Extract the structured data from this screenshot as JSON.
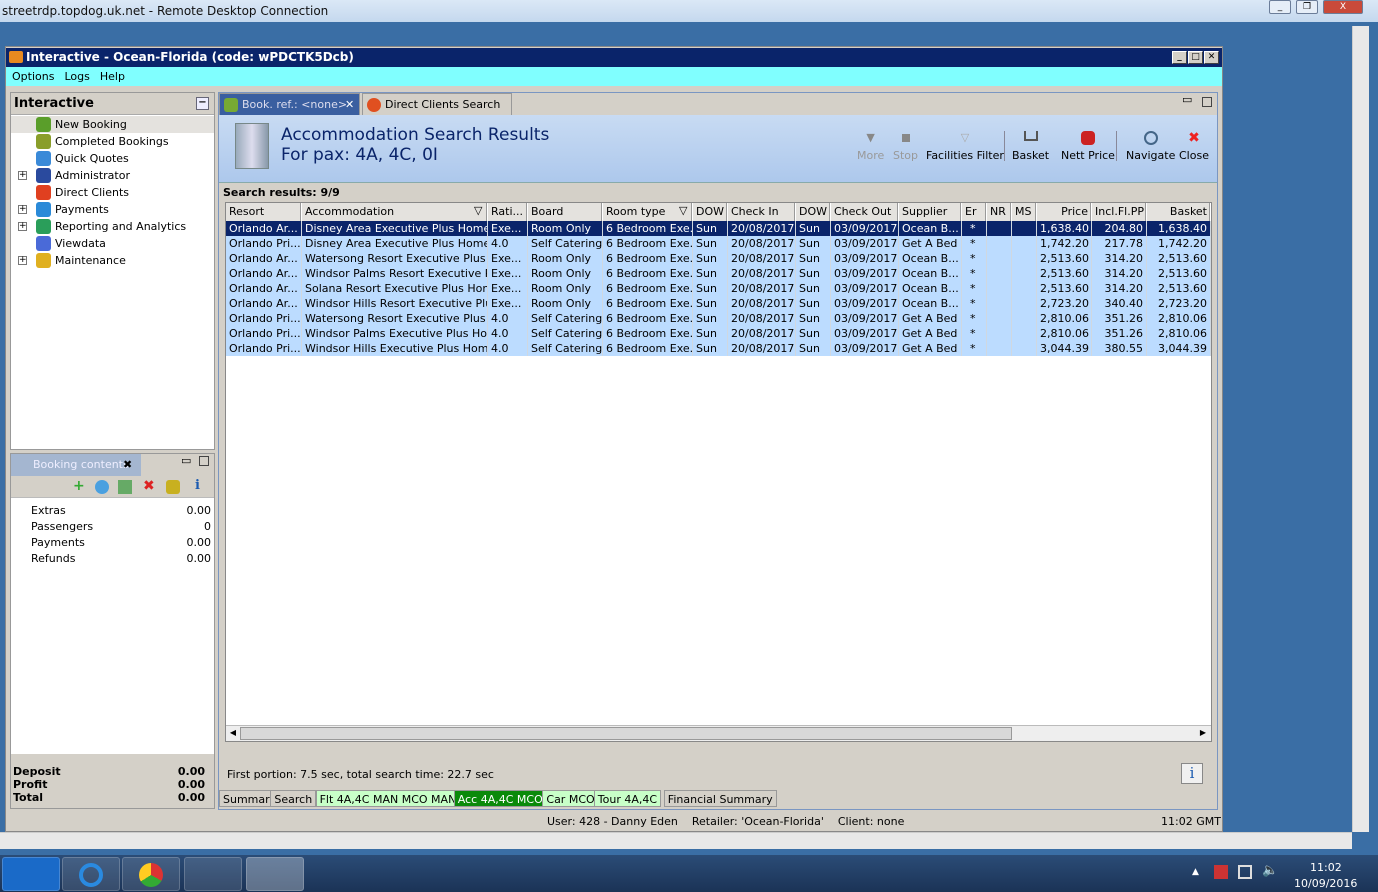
{
  "rdp": {
    "title": "streetrdp.topdog.uk.net - Remote Desktop Connection",
    "minimize": "_",
    "restore": "❐",
    "close": "X"
  },
  "app": {
    "title": "Interactive - Ocean-Florida (code: wPDCTK5Dcb)",
    "menu": [
      "Options",
      "Logs",
      "Help"
    ]
  },
  "left": {
    "title": "Interactive",
    "items": [
      {
        "label": "New Booking",
        "expand": false,
        "color": "#5a9e2a"
      },
      {
        "label": "Completed Bookings",
        "expand": false,
        "color": "#8a9e2a"
      },
      {
        "label": "Quick Quotes",
        "expand": false,
        "color": "#3a8ad8"
      },
      {
        "label": "Administrator",
        "expand": true,
        "color": "#2a4a9e"
      },
      {
        "label": "Direct Clients",
        "expand": false,
        "color": "#e04020"
      },
      {
        "label": "Payments",
        "expand": true,
        "color": "#2a8ad8"
      },
      {
        "label": "Reporting and Analytics",
        "expand": true,
        "color": "#2a9e5a"
      },
      {
        "label": "Viewdata",
        "expand": false,
        "color": "#4a6ad8"
      },
      {
        "label": "Maintenance",
        "expand": true,
        "color": "#e0b020"
      }
    ]
  },
  "booking_contents": {
    "tab": "Booking contents",
    "rows": [
      {
        "label": "Extras",
        "value": "0.00"
      },
      {
        "label": "Passengers",
        "value": "0"
      },
      {
        "label": "Payments",
        "value": "0.00"
      },
      {
        "label": "Refunds",
        "value": "0.00"
      }
    ],
    "summary": [
      {
        "label": "Deposit",
        "value": "0.00"
      },
      {
        "label": "Profit",
        "value": "0.00"
      },
      {
        "label": "Total",
        "value": "0.00"
      }
    ]
  },
  "tabs": [
    {
      "label": "Book. ref.: <none>"
    },
    {
      "label": "Direct Clients Search"
    }
  ],
  "header": {
    "title": "Accommodation Search Results",
    "subtitle": "For pax: 4A, 4C, 0I"
  },
  "toolbar": [
    "More",
    "Stop",
    "Facilities Filter",
    "Basket",
    "Nett Price",
    "Navigate",
    "Close"
  ],
  "results_label": "Search results: 9/9",
  "table": {
    "columns": [
      "Resort",
      "Accommodation",
      "Rati...",
      "Board",
      "Room type",
      "DOW",
      "Check In",
      "DOW",
      "Check Out",
      "Supplier",
      "Er",
      "NR",
      "MS",
      "Price",
      "Incl.Fl.PP",
      "Basket"
    ],
    "rows": [
      [
        "Orlando Ar...",
        "Disney Area Executive Plus Homes",
        "Exe...",
        "Room Only",
        "6 Bedroom Exe...",
        "Sun",
        "20/08/2017",
        "Sun",
        "03/09/2017",
        "Ocean B...",
        "*",
        "",
        "",
        "1,638.40",
        "204.80",
        "1,638.40"
      ],
      [
        "Orlando Pri...",
        "Disney Area Executive Plus Homes",
        "4.0",
        "Self Catering",
        "6 Bedroom Exe...",
        "Sun",
        "20/08/2017",
        "Sun",
        "03/09/2017",
        "Get A Bed",
        "*",
        "",
        "",
        "1,742.20",
        "217.78",
        "1,742.20"
      ],
      [
        "Orlando Ar...",
        "Watersong Resort Executive Plus ...",
        "Exe...",
        "Room Only",
        "6 Bedroom Exe...",
        "Sun",
        "20/08/2017",
        "Sun",
        "03/09/2017",
        "Ocean B...",
        "*",
        "",
        "",
        "2,513.60",
        "314.20",
        "2,513.60"
      ],
      [
        "Orlando Ar...",
        "Windsor Palms Resort Executive Pl...",
        "Exe...",
        "Room Only",
        "6 Bedroom Exe...",
        "Sun",
        "20/08/2017",
        "Sun",
        "03/09/2017",
        "Ocean B...",
        "*",
        "",
        "",
        "2,513.60",
        "314.20",
        "2,513.60"
      ],
      [
        "Orlando Ar...",
        "Solana Resort Executive Plus Homes",
        "Exe...",
        "Room Only",
        "6 Bedroom Exe...",
        "Sun",
        "20/08/2017",
        "Sun",
        "03/09/2017",
        "Ocean B...",
        "*",
        "",
        "",
        "2,513.60",
        "314.20",
        "2,513.60"
      ],
      [
        "Orlando Ar...",
        "Windsor Hills Resort Executive Plus...",
        "Exe...",
        "Room Only",
        "6 Bedroom Exe...",
        "Sun",
        "20/08/2017",
        "Sun",
        "03/09/2017",
        "Ocean B...",
        "*",
        "",
        "",
        "2,723.20",
        "340.40",
        "2,723.20"
      ],
      [
        "Orlando Pri...",
        "Watersong Resort Executive Plus ...",
        "4.0",
        "Self Catering",
        "6 Bedroom Exe...",
        "Sun",
        "20/08/2017",
        "Sun",
        "03/09/2017",
        "Get A Bed",
        "*",
        "",
        "",
        "2,810.06",
        "351.26",
        "2,810.06"
      ],
      [
        "Orlando Pri...",
        "Windsor Palms Executive Plus Homes",
        "4.0",
        "Self Catering",
        "6 Bedroom Exe...",
        "Sun",
        "20/08/2017",
        "Sun",
        "03/09/2017",
        "Get A Bed",
        "*",
        "",
        "",
        "2,810.06",
        "351.26",
        "2,810.06"
      ],
      [
        "Orlando Pri...",
        "Windsor Hills Executive Plus Homes",
        "4.0",
        "Self Catering",
        "6 Bedroom Exe...",
        "Sun",
        "20/08/2017",
        "Sun",
        "03/09/2017",
        "Get A Bed",
        "*",
        "",
        "",
        "3,044.39",
        "380.55",
        "3,044.39"
      ]
    ]
  },
  "footer": {
    "timing": "First portion: 7.5 sec, total search time: 22.7 sec",
    "info": "i"
  },
  "bottom_tabs": [
    {
      "label": "Summary",
      "state": "normal"
    },
    {
      "label": "Search",
      "state": "normal"
    },
    {
      "label": "Flt 4A,4C MAN MCO MAN",
      "state": "light"
    },
    {
      "label": "Acc 4A,4C MCO",
      "state": "active"
    },
    {
      "label": "Car MCO",
      "state": "light"
    },
    {
      "label": "Tour 4A,4C",
      "state": "light"
    },
    {
      "label": "Financial Summary",
      "state": "normal"
    }
  ],
  "status": {
    "text": "User: 428 - Danny Eden    Retailer: 'Ocean-Florida'    Client: none",
    "time": "11:02 GMT"
  },
  "taskbar": {
    "time": "11:02",
    "date": "10/09/2016"
  }
}
